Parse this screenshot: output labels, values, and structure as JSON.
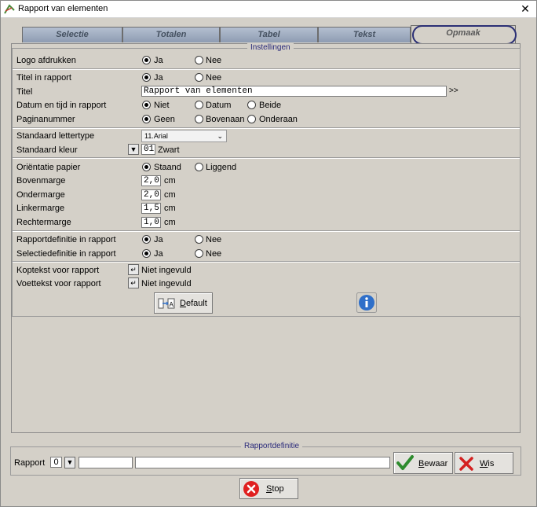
{
  "window": {
    "title": "Rapport van elementen",
    "close_glyph": "✕"
  },
  "tabs": [
    {
      "label": "Selectie"
    },
    {
      "label": "Totalen"
    },
    {
      "label": "Tabel"
    },
    {
      "label": "Tekst"
    },
    {
      "label": "Opmaak",
      "active": true
    }
  ],
  "settings": {
    "legend": "Instellingen",
    "logo": {
      "label": "Logo afdrukken",
      "options": [
        "Ja",
        "Nee"
      ],
      "selected": "Ja"
    },
    "titel_in_rapport": {
      "label": "Titel in rapport",
      "options": [
        "Ja",
        "Nee"
      ],
      "selected": "Ja"
    },
    "titel": {
      "label": "Titel",
      "value": "Rapport van elementen",
      "more": ">>"
    },
    "datum": {
      "label": "Datum en tijd in rapport",
      "options": [
        "Niet",
        "Datum",
        "Beide"
      ],
      "selected": "Niet"
    },
    "pagina": {
      "label": "Paginanummer",
      "options": [
        "Geen",
        "Bovenaan",
        "Onderaan"
      ],
      "selected": "Geen"
    },
    "lettertype": {
      "label": "Standaard lettertype",
      "value": "11.Arial"
    },
    "kleur": {
      "label": "Standaard kleur",
      "code": "01",
      "name": "Zwart"
    },
    "orientatie": {
      "label": "Oriëntatie papier",
      "options": [
        "Staand",
        "Liggend"
      ],
      "selected": "Staand"
    },
    "bovenmarge": {
      "label": "Bovenmarge",
      "value": "2,0",
      "unit": "cm"
    },
    "ondermarge": {
      "label": "Ondermarge",
      "value": "2,0",
      "unit": "cm"
    },
    "linkermarge": {
      "label": "Linkermarge",
      "value": "1,5",
      "unit": "cm"
    },
    "rechtermarge": {
      "label": "Rechtermarge",
      "value": "1,0",
      "unit": "cm"
    },
    "rapportdef": {
      "label": "Rapportdefinitie in rapport",
      "options": [
        "Ja",
        "Nee"
      ],
      "selected": "Ja"
    },
    "selectiedef": {
      "label": "Selectiedefinitie in rapport",
      "options": [
        "Ja",
        "Nee"
      ],
      "selected": "Ja"
    },
    "koptekst": {
      "label": "Koptekst voor rapport",
      "value": "Niet ingevuld"
    },
    "voettekst": {
      "label": "Voettekst voor rapport",
      "value": "Niet ingevuld"
    },
    "default_button": "Default",
    "default_button_mnemonic": "D",
    "default_button_rest": "efault"
  },
  "rapportdefinitie": {
    "legend": "Rapportdefinitie",
    "label": "Rapport",
    "code": "0",
    "bewaar_mnemonic": "B",
    "bewaar_rest": "ewaar",
    "wis_mnemonic": "W",
    "wis_rest": "is"
  },
  "stop_button": {
    "mnemonic": "S",
    "rest": "top"
  },
  "colors": {
    "tab_inactive": "#9aa7bc",
    "highlight": "#2b2f75",
    "check": "#2e8b2e",
    "cross": "#d42020",
    "stop": "#e02020",
    "info": "#2f6fc9"
  }
}
